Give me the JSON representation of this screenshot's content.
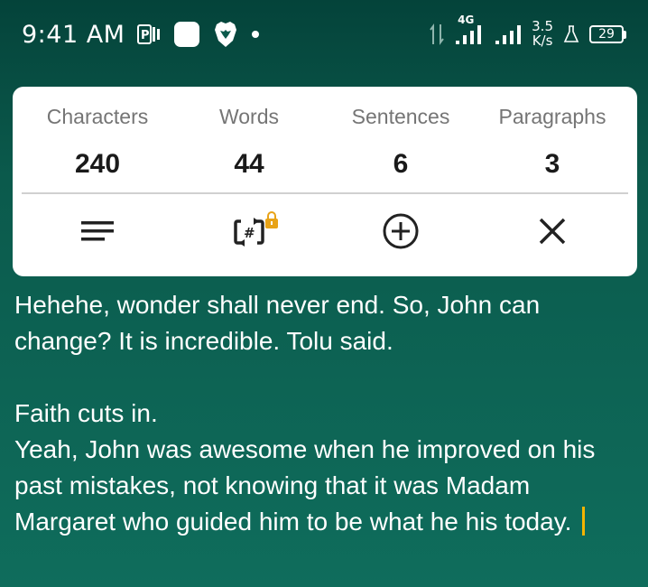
{
  "status_bar": {
    "time": "9:41 AM",
    "network_type": "4G",
    "speed_value": "3.5",
    "speed_unit": "K/s",
    "battery": "29",
    "icons": [
      "p-icon",
      "white-square-icon",
      "brave-icon",
      "dot-icon",
      "data-arrows-icon",
      "signal-icon",
      "signal-icon-2",
      "flask-icon",
      "battery-icon"
    ]
  },
  "stats": [
    {
      "label": "Characters",
      "value": "240"
    },
    {
      "label": "Words",
      "value": "44"
    },
    {
      "label": "Sentences",
      "value": "6"
    },
    {
      "label": "Paragraphs",
      "value": "3"
    }
  ],
  "toolbar": {
    "icons": [
      "align-lines-icon",
      "hashtag-swap-icon",
      "add-circle-icon",
      "close-icon"
    ],
    "lock_icon": "lock-icon",
    "lock_color": "#e8a317"
  },
  "editor": {
    "text": "Hehehe, wonder shall never end. So, John can change? It is incredible. Tolu said.\n\nFaith cuts in.\nYeah, John was awesome when he improved on his past mistakes, not knowing that it was Madam Margaret who guided him to be what he his today."
  },
  "colors": {
    "background_top": "#04433a",
    "background_bottom": "#0f6d5c",
    "caret": "#f4b400"
  }
}
